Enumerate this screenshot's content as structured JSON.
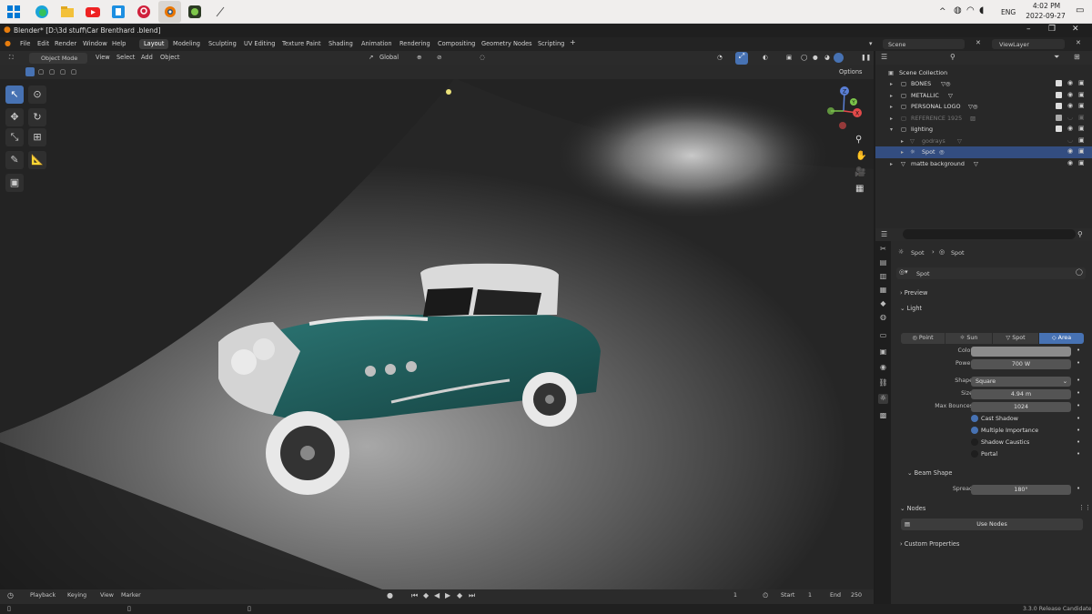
{
  "taskbar": {
    "tray_lang": "ENG",
    "time": "4:02 PM",
    "date": "2022-09-27",
    "tray_chevron": "^"
  },
  "window": {
    "title": "Blender* [D:\\3d stuff\\Car Brenthard .blend]"
  },
  "menu": [
    "File",
    "Edit",
    "Render",
    "Window",
    "Help"
  ],
  "workspaces": [
    "Layout",
    "Modeling",
    "Sculpting",
    "UV Editing",
    "Texture Paint",
    "Shading",
    "Animation",
    "Rendering",
    "Compositing",
    "Geometry Nodes",
    "Scripting"
  ],
  "active_workspace": "Layout",
  "scene": {
    "name": "Scene",
    "view_layer": "ViewLayer"
  },
  "viewport": {
    "mode": "Object Mode",
    "menus": [
      "View",
      "Select",
      "Add",
      "Object"
    ],
    "transform_orientation": "Global",
    "options_label": "Options",
    "gizmo_axes": [
      "Z",
      "Y",
      "X"
    ]
  },
  "outliner": {
    "root": "Scene Collection",
    "items": [
      {
        "name": "BONES",
        "dim": false,
        "indent": 0
      },
      {
        "name": "METALLIC",
        "dim": false,
        "indent": 0
      },
      {
        "name": "PERSONAL LOGO",
        "dim": false,
        "indent": 0
      },
      {
        "name": "REFERENCE 1925",
        "dim": true,
        "indent": 0
      },
      {
        "name": "lighting",
        "dim": false,
        "indent": 0
      },
      {
        "name": "godrays",
        "dim": true,
        "indent": 1
      },
      {
        "name": "Spot",
        "dim": false,
        "indent": 1
      },
      {
        "name": "matte background",
        "dim": false,
        "indent": 0
      }
    ]
  },
  "properties": {
    "breadcrumb": [
      "Spot",
      "Spot"
    ],
    "datablock": "Spot",
    "panels": {
      "preview": "Preview",
      "light": "Light",
      "beam_shape": "Beam Shape",
      "nodes": "Nodes",
      "custom": "Custom Properties"
    },
    "light_types": [
      "Point",
      "Sun",
      "Spot",
      "Area"
    ],
    "active_light_type": "Area",
    "fields": {
      "color_label": "Color",
      "power_label": "Power",
      "power_value": "700 W",
      "shape_label": "Shape",
      "shape_value": "Square",
      "size_label": "Size",
      "size_value": "4.94 m",
      "bounces_label": "Max Bounces",
      "bounces_value": "1024",
      "spread_label": "Spread",
      "spread_value": "180°"
    },
    "checkboxes": [
      {
        "label": "Cast Shadow",
        "checked": true
      },
      {
        "label": "Multiple Importance",
        "checked": true
      },
      {
        "label": "Shadow Caustics",
        "checked": false
      },
      {
        "label": "Portal",
        "checked": false
      }
    ],
    "use_nodes_label": "Use Nodes"
  },
  "timeline": {
    "menus": [
      "Playback",
      "Keying",
      "View",
      "Marker"
    ],
    "current_frame": "1",
    "start_label": "Start",
    "start_value": "1",
    "end_label": "End",
    "end_value": "250"
  },
  "status": {
    "version": "3.3.0 Release Candidate"
  },
  "colors": {
    "accent": "#4772b3",
    "car_body": "#1f5a58"
  }
}
